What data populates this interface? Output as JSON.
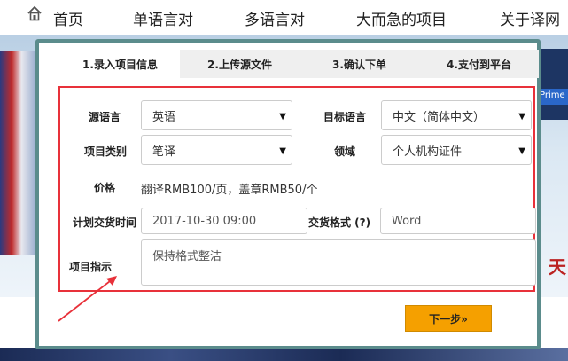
{
  "nav": {
    "items": [
      "首页",
      "单语言对",
      "多语言对",
      "大而急的项目",
      "关于译网"
    ]
  },
  "background": {
    "logo_text": "Prime",
    "corner_char": "天"
  },
  "tabs": [
    {
      "label": "1.录入项目信息",
      "active": true
    },
    {
      "label": "2.上传源文件",
      "active": false
    },
    {
      "label": "3.确认下单",
      "active": false
    },
    {
      "label": "4.支付到平台",
      "active": false
    }
  ],
  "form": {
    "source_lang_label": "源语言",
    "source_lang_value": "英语",
    "target_lang_label": "目标语言",
    "target_lang_value": "中文（简体中文）",
    "project_type_label": "项目类别",
    "project_type_value": "笔译",
    "domain_label": "领域",
    "domain_value": "个人机构证件",
    "price_label": "价格",
    "price_value": "翻译RMB100/页，盖章RMB50/个",
    "delivery_time_label": "计划交货时间",
    "delivery_time_value": "2017-10-30 09:00",
    "delivery_format_label": "交货格式 (?)",
    "delivery_format_value": "Word",
    "instructions_label": "项目指示",
    "instructions_value": "保持格式整洁"
  },
  "next_button_label": "下一步»",
  "colors": {
    "modal_border": "#5b8c8c",
    "highlight_frame": "#e8313a",
    "next_button": "#f5a000"
  }
}
